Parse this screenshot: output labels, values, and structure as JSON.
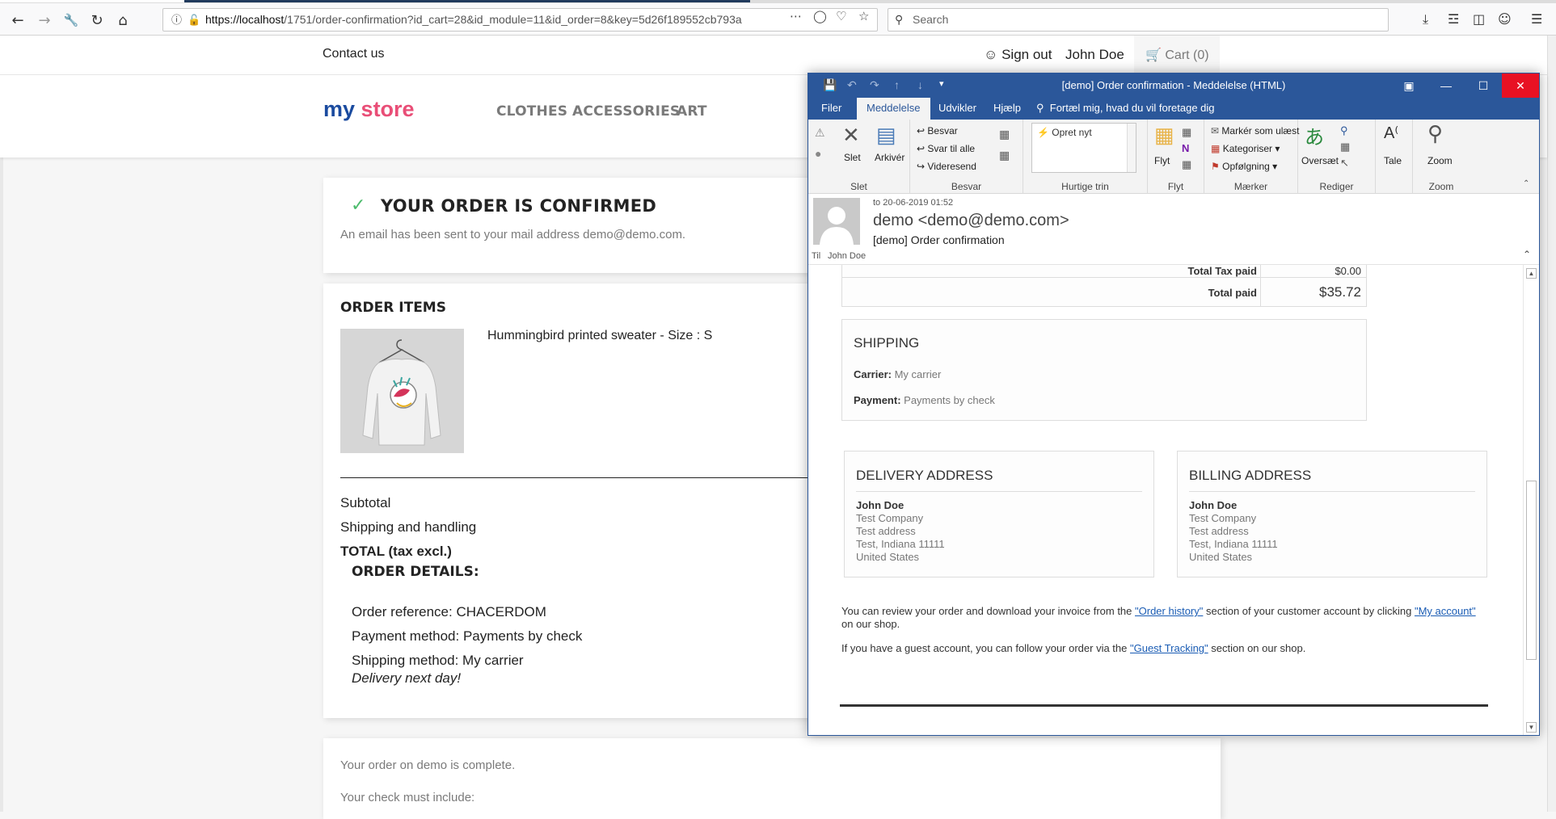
{
  "browser": {
    "url_host": "https://localhost",
    "url_path": "/1751/order-confirmation?id_cart=28&id_module=11&id_order=8&key=5d26f189552cb793a",
    "search_placeholder": "Search"
  },
  "store": {
    "contact_label": "Contact us",
    "signout_label": "Sign out",
    "user_name": "John Doe",
    "cart_label": "Cart (0)",
    "logo_my": "my",
    "logo_store": "store",
    "menu": [
      "CLOTHES",
      "ACCESSORIES",
      "ART"
    ]
  },
  "confirmation": {
    "title": "YOUR ORDER IS CONFIRMED",
    "subtitle": "An email has been sent to your mail address demo@demo.com."
  },
  "order_items": {
    "title": "ORDER ITEMS",
    "product_name": "Hummingbird printed sweater - Size : S",
    "subtotal_label": "Subtotal",
    "shipping_label": "Shipping and handling",
    "total_label": "TOTAL (tax excl.)"
  },
  "order_details": {
    "title": "ORDER DETAILS:",
    "reference": "Order reference: CHACERDOM",
    "payment": "Payment method: Payments by check",
    "shipping": "Shipping method: My carrier",
    "delivery": "Delivery next day!"
  },
  "footer_card": {
    "line1": "Your order on demo is complete.",
    "line2": "Your check must include:"
  },
  "outlook": {
    "title": "[demo] Order confirmation  -  Meddelelse (HTML)",
    "tabs": [
      "Filer",
      "Meddelelse",
      "Udvikler",
      "Hjælp",
      "Fortæl mig, hvad du vil foretage dig"
    ],
    "ribbon": {
      "slet": "Slet",
      "arkiver": "Arkivér",
      "group_slet": "Slet",
      "besvar": "Besvar",
      "svar_til_alle": "Svar til alle",
      "videresend": "Videresend",
      "group_besvar": "Besvar",
      "opret_nyt": "Opret nyt",
      "group_hurtige": "Hurtige trin",
      "flyt": "Flyt",
      "group_flyt": "Flyt",
      "marker_ulaest": "Markér som ulæst",
      "kategoriser": "Kategoriser",
      "opfolgning": "Opfølgning",
      "group_maerker": "Mærker",
      "oversaet": "Oversæt",
      "group_rediger": "Rediger",
      "tale": "Tale",
      "zoom": "Zoom",
      "group_zoom": "Zoom"
    },
    "header": {
      "date": "to 20-06-2019 01:52",
      "from": "demo <demo@demo.com>",
      "subject": "[demo] Order confirmation",
      "to_label": "Til",
      "to_name": "John Doe"
    },
    "body": {
      "total_tax_label": "Total Tax paid",
      "total_tax_value": "$0.00",
      "total_paid_label": "Total paid",
      "total_paid_value": "$35.72",
      "shipping_title": "SHIPPING",
      "carrier_label": "Carrier:",
      "carrier_value": "My carrier",
      "payment_label": "Payment:",
      "payment_value": "Payments by check",
      "delivery_title": "DELIVERY ADDRESS",
      "billing_title": "BILLING ADDRESS",
      "address": [
        "John Doe",
        "Test Company",
        "Test address",
        "Test, Indiana 11111",
        "United States"
      ],
      "review_text_1": "You can review your order and download your invoice from the ",
      "review_link_1": "\"Order history\"",
      "review_text_2": " section of your customer account by clicking ",
      "review_link_2": "\"My account\"",
      "review_text_3": " on our shop.",
      "guest_text_1": "If you have a guest account, you can follow your order via the ",
      "guest_link": "\"Guest Tracking\"",
      "guest_text_2": " section on our shop."
    }
  }
}
